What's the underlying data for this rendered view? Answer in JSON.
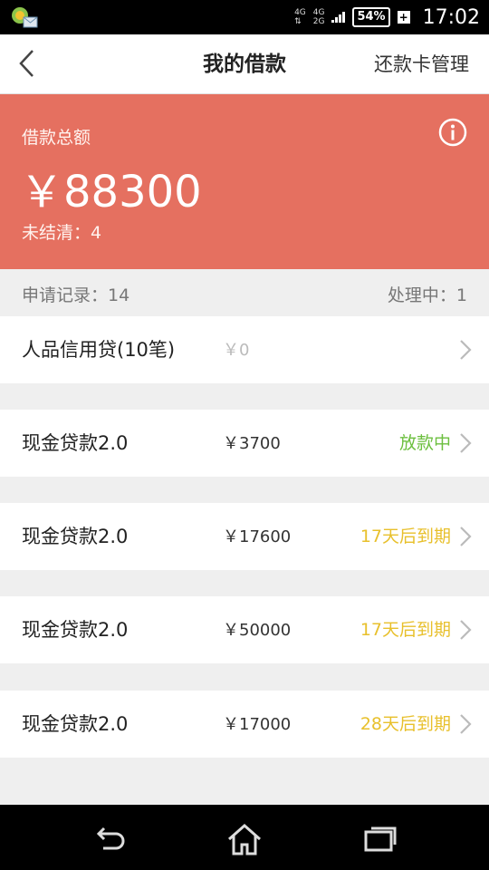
{
  "status_bar": {
    "net_top": "4G",
    "net_bottom_left": "4G",
    "net_bottom_right": "2G",
    "battery": "54%",
    "time": "17:02"
  },
  "nav": {
    "title": "我的借款",
    "action": "还款卡管理"
  },
  "summary": {
    "label": "借款总额",
    "amount": "￥88300",
    "unsettled": "未结清：4"
  },
  "meta": {
    "records": "申请记录：14",
    "processing": "处理中：1"
  },
  "loans": [
    {
      "name": "人品信用贷(10笔)",
      "amount": "￥0",
      "status": ""
    },
    {
      "name": "现金贷款2.0",
      "amount": "￥3700",
      "status": "放款中"
    },
    {
      "name": "现金贷款2.0",
      "amount": "￥17600",
      "status": "17天后到期"
    },
    {
      "name": "现金贷款2.0",
      "amount": "￥50000",
      "status": "17天后到期"
    },
    {
      "name": "现金贷款2.0",
      "amount": "￥17000",
      "status": "28天后到期"
    }
  ],
  "colors": {
    "summary_bg": "#e57060",
    "status_processing": "#6cbf3f",
    "status_due": "#e8c02c"
  }
}
